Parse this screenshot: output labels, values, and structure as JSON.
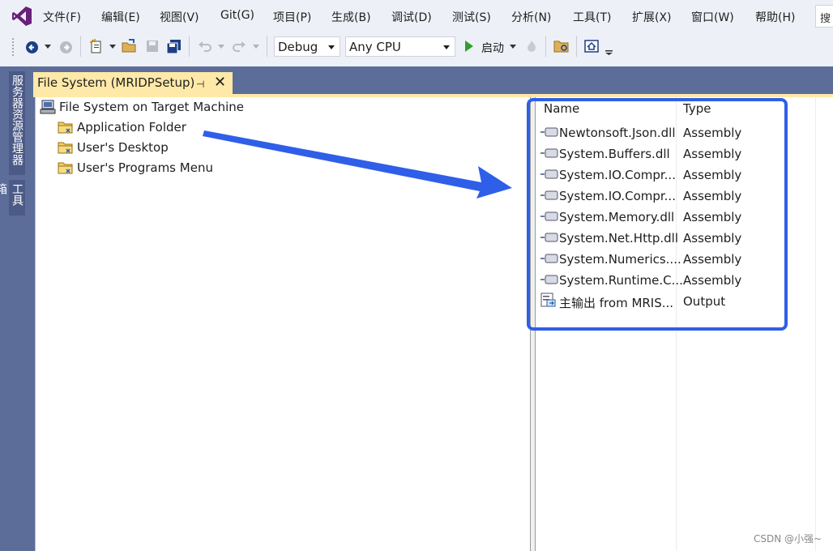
{
  "menubar": {
    "items": [
      "文件(F)",
      "编辑(E)",
      "视图(V)",
      "Git(G)",
      "项目(P)",
      "生成(B)",
      "调试(D)",
      "测试(S)",
      "分析(N)",
      "工具(T)",
      "扩展(X)",
      "窗口(W)",
      "帮助(H)"
    ],
    "search_text": "搜"
  },
  "toolbar": {
    "config_value": "Debug",
    "platform_value": "Any CPU",
    "start_label": "启动"
  },
  "sidebar": {
    "tabs": [
      "服务器资源管理器",
      "工具箱"
    ]
  },
  "document_tab": {
    "title": "File System (MRIDPSetup)",
    "pin_glyph": "⊣",
    "close_glyph": "✕"
  },
  "tree": {
    "root": "File System on Target Machine",
    "children": [
      "Application Folder",
      "User's Desktop",
      "User's Programs Menu"
    ]
  },
  "list": {
    "columns": [
      "Name",
      "Type"
    ],
    "rows": [
      {
        "name": "Newtonsoft.Json.dll",
        "type": "Assembly"
      },
      {
        "name": "System.Buffers.dll",
        "type": "Assembly"
      },
      {
        "name": "System.IO.Compr...",
        "type": "Assembly"
      },
      {
        "name": "System.IO.Compr...",
        "type": "Assembly"
      },
      {
        "name": "System.Memory.dll",
        "type": "Assembly"
      },
      {
        "name": "System.Net.Http.dll",
        "type": "Assembly"
      },
      {
        "name": "System.Numerics....",
        "type": "Assembly"
      },
      {
        "name": "System.Runtime.C...",
        "type": "Assembly"
      },
      {
        "name": "主输出 from MRIS...",
        "type": "Output"
      }
    ]
  },
  "watermark": "CSDN @小强~",
  "colors": {
    "accent_tab": "#ffe9a8",
    "chrome_dark": "#5c6d99",
    "annotation": "#2f5fe8",
    "vs_purple": "#68217a"
  },
  "icons": {
    "logo": "visual-studio-logo-icon",
    "folder": "folder-icon",
    "computer": "computer-icon",
    "assembly": "assembly-icon",
    "output": "project-output-icon"
  }
}
